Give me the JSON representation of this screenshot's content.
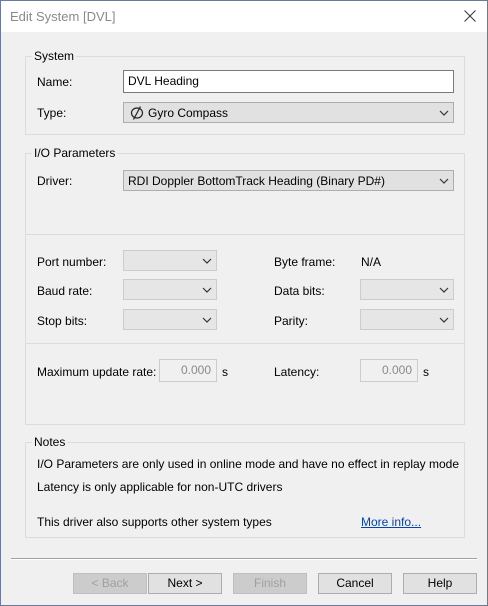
{
  "window": {
    "title": "Edit System [DVL]"
  },
  "system": {
    "group_label": "System",
    "name_label": "Name:",
    "name_value": "DVL Heading",
    "type_label": "Type:",
    "type_value": "Gyro Compass",
    "type_icon": "gyro-compass-icon"
  },
  "io": {
    "group_label": "I/O Parameters",
    "driver_label": "Driver:",
    "driver_value": "RDI Doppler BottomTrack Heading (Binary PD#)",
    "port_label": "Port number:",
    "baud_label": "Baud rate:",
    "stop_label": "Stop bits:",
    "byte_frame_label": "Byte frame:",
    "byte_frame_value": "N/A",
    "data_bits_label": "Data bits:",
    "parity_label": "Parity:",
    "max_rate_label": "Maximum update rate:",
    "max_rate_value": "0.000",
    "max_rate_unit": "s",
    "latency_label": "Latency:",
    "latency_value": "0.000",
    "latency_unit": "s"
  },
  "notes": {
    "group_label": "Notes",
    "line1": "I/O Parameters are only used in online mode and have no effect in replay mode",
    "line2": "Latency is only applicable for non-UTC drivers",
    "line3": "This driver also supports other system types",
    "more_info": "More info..."
  },
  "buttons": {
    "back": "< Back",
    "next": "Next >",
    "finish": "Finish",
    "cancel": "Cancel",
    "help": "Help"
  }
}
